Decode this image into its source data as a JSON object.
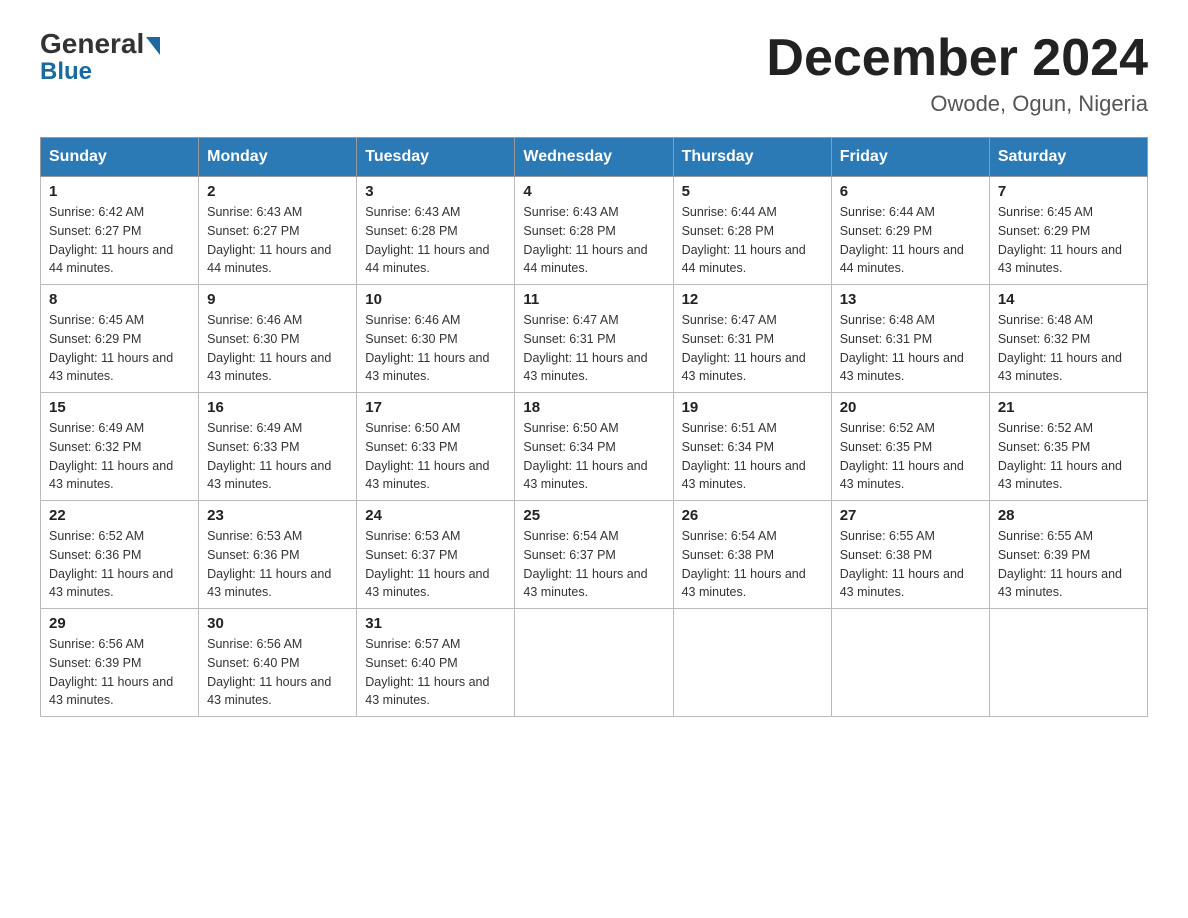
{
  "header": {
    "logo_general": "General",
    "logo_blue": "Blue",
    "title": "December 2024",
    "subtitle": "Owode, Ogun, Nigeria"
  },
  "weekdays": [
    "Sunday",
    "Monday",
    "Tuesday",
    "Wednesday",
    "Thursday",
    "Friday",
    "Saturday"
  ],
  "weeks": [
    [
      {
        "day": "1",
        "sunrise": "6:42 AM",
        "sunset": "6:27 PM",
        "daylight": "11 hours and 44 minutes."
      },
      {
        "day": "2",
        "sunrise": "6:43 AM",
        "sunset": "6:27 PM",
        "daylight": "11 hours and 44 minutes."
      },
      {
        "day": "3",
        "sunrise": "6:43 AM",
        "sunset": "6:28 PM",
        "daylight": "11 hours and 44 minutes."
      },
      {
        "day": "4",
        "sunrise": "6:43 AM",
        "sunset": "6:28 PM",
        "daylight": "11 hours and 44 minutes."
      },
      {
        "day": "5",
        "sunrise": "6:44 AM",
        "sunset": "6:28 PM",
        "daylight": "11 hours and 44 minutes."
      },
      {
        "day": "6",
        "sunrise": "6:44 AM",
        "sunset": "6:29 PM",
        "daylight": "11 hours and 44 minutes."
      },
      {
        "day": "7",
        "sunrise": "6:45 AM",
        "sunset": "6:29 PM",
        "daylight": "11 hours and 43 minutes."
      }
    ],
    [
      {
        "day": "8",
        "sunrise": "6:45 AM",
        "sunset": "6:29 PM",
        "daylight": "11 hours and 43 minutes."
      },
      {
        "day": "9",
        "sunrise": "6:46 AM",
        "sunset": "6:30 PM",
        "daylight": "11 hours and 43 minutes."
      },
      {
        "day": "10",
        "sunrise": "6:46 AM",
        "sunset": "6:30 PM",
        "daylight": "11 hours and 43 minutes."
      },
      {
        "day": "11",
        "sunrise": "6:47 AM",
        "sunset": "6:31 PM",
        "daylight": "11 hours and 43 minutes."
      },
      {
        "day": "12",
        "sunrise": "6:47 AM",
        "sunset": "6:31 PM",
        "daylight": "11 hours and 43 minutes."
      },
      {
        "day": "13",
        "sunrise": "6:48 AM",
        "sunset": "6:31 PM",
        "daylight": "11 hours and 43 minutes."
      },
      {
        "day": "14",
        "sunrise": "6:48 AM",
        "sunset": "6:32 PM",
        "daylight": "11 hours and 43 minutes."
      }
    ],
    [
      {
        "day": "15",
        "sunrise": "6:49 AM",
        "sunset": "6:32 PM",
        "daylight": "11 hours and 43 minutes."
      },
      {
        "day": "16",
        "sunrise": "6:49 AM",
        "sunset": "6:33 PM",
        "daylight": "11 hours and 43 minutes."
      },
      {
        "day": "17",
        "sunrise": "6:50 AM",
        "sunset": "6:33 PM",
        "daylight": "11 hours and 43 minutes."
      },
      {
        "day": "18",
        "sunrise": "6:50 AM",
        "sunset": "6:34 PM",
        "daylight": "11 hours and 43 minutes."
      },
      {
        "day": "19",
        "sunrise": "6:51 AM",
        "sunset": "6:34 PM",
        "daylight": "11 hours and 43 minutes."
      },
      {
        "day": "20",
        "sunrise": "6:52 AM",
        "sunset": "6:35 PM",
        "daylight": "11 hours and 43 minutes."
      },
      {
        "day": "21",
        "sunrise": "6:52 AM",
        "sunset": "6:35 PM",
        "daylight": "11 hours and 43 minutes."
      }
    ],
    [
      {
        "day": "22",
        "sunrise": "6:52 AM",
        "sunset": "6:36 PM",
        "daylight": "11 hours and 43 minutes."
      },
      {
        "day": "23",
        "sunrise": "6:53 AM",
        "sunset": "6:36 PM",
        "daylight": "11 hours and 43 minutes."
      },
      {
        "day": "24",
        "sunrise": "6:53 AM",
        "sunset": "6:37 PM",
        "daylight": "11 hours and 43 minutes."
      },
      {
        "day": "25",
        "sunrise": "6:54 AM",
        "sunset": "6:37 PM",
        "daylight": "11 hours and 43 minutes."
      },
      {
        "day": "26",
        "sunrise": "6:54 AM",
        "sunset": "6:38 PM",
        "daylight": "11 hours and 43 minutes."
      },
      {
        "day": "27",
        "sunrise": "6:55 AM",
        "sunset": "6:38 PM",
        "daylight": "11 hours and 43 minutes."
      },
      {
        "day": "28",
        "sunrise": "6:55 AM",
        "sunset": "6:39 PM",
        "daylight": "11 hours and 43 minutes."
      }
    ],
    [
      {
        "day": "29",
        "sunrise": "6:56 AM",
        "sunset": "6:39 PM",
        "daylight": "11 hours and 43 minutes."
      },
      {
        "day": "30",
        "sunrise": "6:56 AM",
        "sunset": "6:40 PM",
        "daylight": "11 hours and 43 minutes."
      },
      {
        "day": "31",
        "sunrise": "6:57 AM",
        "sunset": "6:40 PM",
        "daylight": "11 hours and 43 minutes."
      },
      null,
      null,
      null,
      null
    ]
  ]
}
